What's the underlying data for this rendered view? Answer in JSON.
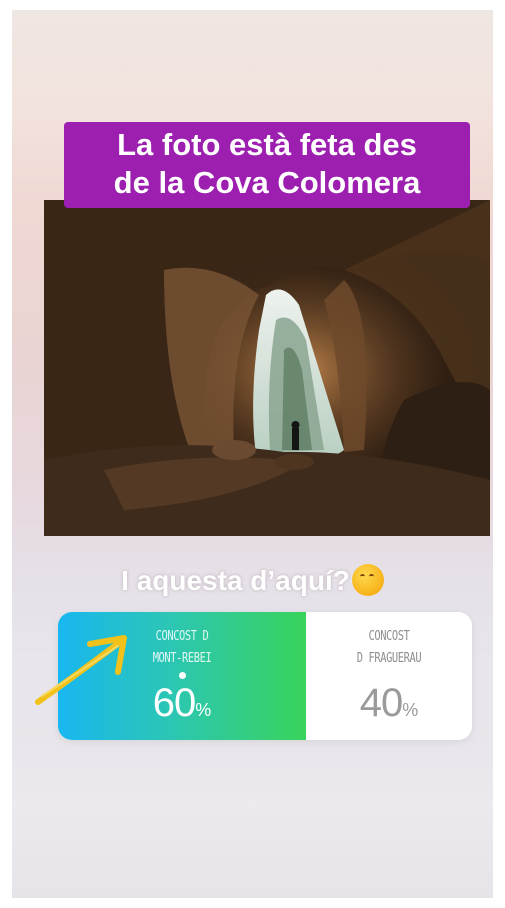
{
  "caption": {
    "line1": "La foto està feta des",
    "line2": "de la Cova Colomera"
  },
  "photo": {
    "subject": "cave-opening-with-hiker"
  },
  "question": {
    "text": "I aquesta d’aquí?",
    "emoji": "face-with-hand-over-mouth-icon"
  },
  "poll": {
    "options": [
      {
        "line1": "CONCOST D",
        "line2": "MONT-REBEI",
        "percent": "60",
        "percent_sign": "%",
        "selected": true,
        "share": 0.6
      },
      {
        "line1": "CONCOST",
        "line2": "D FRAGUERAU",
        "percent": "40",
        "percent_sign": "%",
        "selected": false,
        "share": 0.4
      }
    ]
  },
  "annotation": {
    "icon": "hand-drawn-arrow-icon",
    "color": "#f2c21b"
  },
  "colors": {
    "caption_bg": "#9c1fb0",
    "poll_gradient_start": "#18b7f0",
    "poll_gradient_end": "#38d35a"
  }
}
